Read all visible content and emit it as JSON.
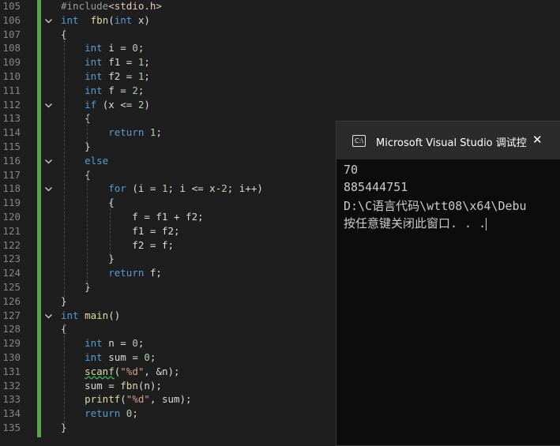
{
  "editor": {
    "lines": [
      {
        "n": "105",
        "fold": "",
        "tokens": [
          [
            "pp",
            "#include"
          ],
          [
            "inc",
            "<stdio.h>"
          ]
        ]
      },
      {
        "n": "106",
        "fold": "v",
        "tokens": [
          [
            "kw",
            "int"
          ],
          [
            "",
            "  "
          ],
          [
            "fn",
            "fbn"
          ],
          [
            "",
            "("
          ],
          [
            "kw",
            "int"
          ],
          [
            "",
            " x)"
          ]
        ]
      },
      {
        "n": "107",
        "fold": "",
        "tokens": [
          [
            "",
            "{"
          ]
        ]
      },
      {
        "n": "108",
        "fold": "",
        "tokens": [
          [
            "",
            "    "
          ],
          [
            "kw",
            "int"
          ],
          [
            "",
            " i = "
          ],
          [
            "num",
            "0"
          ],
          [
            "",
            ";"
          ]
        ]
      },
      {
        "n": "109",
        "fold": "",
        "tokens": [
          [
            "",
            "    "
          ],
          [
            "kw",
            "int"
          ],
          [
            "",
            " f1 = "
          ],
          [
            "num",
            "1"
          ],
          [
            "",
            ";"
          ]
        ]
      },
      {
        "n": "110",
        "fold": "",
        "tokens": [
          [
            "",
            "    "
          ],
          [
            "kw",
            "int"
          ],
          [
            "",
            " f2 = "
          ],
          [
            "num",
            "1"
          ],
          [
            "",
            ";"
          ]
        ]
      },
      {
        "n": "111",
        "fold": "",
        "tokens": [
          [
            "",
            "    "
          ],
          [
            "kw",
            "int"
          ],
          [
            "",
            " f = "
          ],
          [
            "num",
            "2"
          ],
          [
            "",
            ";"
          ]
        ]
      },
      {
        "n": "112",
        "fold": "v",
        "tokens": [
          [
            "",
            "    "
          ],
          [
            "kw",
            "if"
          ],
          [
            "",
            " (x <= "
          ],
          [
            "num",
            "2"
          ],
          [
            "",
            ")"
          ]
        ]
      },
      {
        "n": "113",
        "fold": "",
        "tokens": [
          [
            "",
            "    {"
          ]
        ]
      },
      {
        "n": "114",
        "fold": "",
        "tokens": [
          [
            "",
            "        "
          ],
          [
            "kw",
            "return"
          ],
          [
            "",
            " "
          ],
          [
            "num",
            "1"
          ],
          [
            "",
            ";"
          ]
        ]
      },
      {
        "n": "115",
        "fold": "",
        "tokens": [
          [
            "",
            "    }"
          ]
        ]
      },
      {
        "n": "116",
        "fold": "v",
        "tokens": [
          [
            "",
            "    "
          ],
          [
            "kw",
            "else"
          ]
        ]
      },
      {
        "n": "117",
        "fold": "",
        "tokens": [
          [
            "",
            "    {"
          ]
        ]
      },
      {
        "n": "118",
        "fold": "v",
        "tokens": [
          [
            "",
            "        "
          ],
          [
            "kw",
            "for"
          ],
          [
            "",
            " (i = "
          ],
          [
            "num",
            "1"
          ],
          [
            "",
            "; i <= x-"
          ],
          [
            "num",
            "2"
          ],
          [
            "",
            "; i++)"
          ]
        ]
      },
      {
        "n": "119",
        "fold": "",
        "tokens": [
          [
            "",
            "        {"
          ]
        ]
      },
      {
        "n": "120",
        "fold": "",
        "tokens": [
          [
            "",
            "            f = f1 + f2;"
          ]
        ]
      },
      {
        "n": "121",
        "fold": "",
        "tokens": [
          [
            "",
            "            f1 = f2;"
          ]
        ]
      },
      {
        "n": "122",
        "fold": "",
        "tokens": [
          [
            "",
            "            f2 = f;"
          ]
        ]
      },
      {
        "n": "123",
        "fold": "",
        "tokens": [
          [
            "",
            "        }"
          ]
        ]
      },
      {
        "n": "124",
        "fold": "",
        "tokens": [
          [
            "",
            "        "
          ],
          [
            "kw",
            "return"
          ],
          [
            "",
            " f;"
          ]
        ]
      },
      {
        "n": "125",
        "fold": "",
        "tokens": [
          [
            "",
            "    }"
          ]
        ]
      },
      {
        "n": "126",
        "fold": "",
        "tokens": [
          [
            "",
            "}"
          ]
        ]
      },
      {
        "n": "127",
        "fold": "v",
        "tokens": [
          [
            "kw",
            "int"
          ],
          [
            "",
            " "
          ],
          [
            "fn",
            "main"
          ],
          [
            "",
            "()"
          ]
        ]
      },
      {
        "n": "128",
        "fold": "",
        "tokens": [
          [
            "",
            "{"
          ]
        ]
      },
      {
        "n": "129",
        "fold": "",
        "tokens": [
          [
            "",
            "    "
          ],
          [
            "kw",
            "int"
          ],
          [
            "",
            " n = "
          ],
          [
            "num",
            "0"
          ],
          [
            "",
            ";"
          ]
        ]
      },
      {
        "n": "130",
        "fold": "",
        "tokens": [
          [
            "",
            "    "
          ],
          [
            "kw",
            "int"
          ],
          [
            "",
            " sum = "
          ],
          [
            "num",
            "0"
          ],
          [
            "",
            ";"
          ]
        ]
      },
      {
        "n": "131",
        "fold": "",
        "tokens": [
          [
            "",
            "    "
          ],
          [
            "fn squig",
            "scanf"
          ],
          [
            "",
            "("
          ],
          [
            "str",
            "\"%d\""
          ],
          [
            "",
            ", &n);"
          ]
        ]
      },
      {
        "n": "132",
        "fold": "",
        "tokens": [
          [
            "",
            "    sum = "
          ],
          [
            "fn",
            "fbn"
          ],
          [
            "",
            "(n);"
          ]
        ]
      },
      {
        "n": "133",
        "fold": "",
        "tokens": [
          [
            "",
            "    "
          ],
          [
            "fn",
            "printf"
          ],
          [
            "",
            "("
          ],
          [
            "str",
            "\"%d\""
          ],
          [
            "",
            ", sum);"
          ]
        ]
      },
      {
        "n": "134",
        "fold": "",
        "tokens": [
          [
            "",
            "    "
          ],
          [
            "kw",
            "return"
          ],
          [
            "",
            " "
          ],
          [
            "num",
            "0"
          ],
          [
            "",
            ";"
          ]
        ]
      },
      {
        "n": "135",
        "fold": "",
        "tokens": [
          [
            "",
            "}"
          ]
        ]
      }
    ]
  },
  "console": {
    "title": "Microsoft Visual Studio 调试控",
    "close_glyph": "✕",
    "icon_glyph": "C:\\",
    "output": [
      "70",
      "885444751",
      "D:\\C语言代码\\wtt08\\x64\\Debu",
      "按任意键关闭此窗口. . ."
    ]
  },
  "colors": {
    "editor_bg": "#1e1e1e",
    "keyword": "#569cd6",
    "function": "#dcdcaa",
    "string": "#d69d85",
    "change_bar": "#57a64a",
    "console_bg": "#0c0c0c"
  }
}
